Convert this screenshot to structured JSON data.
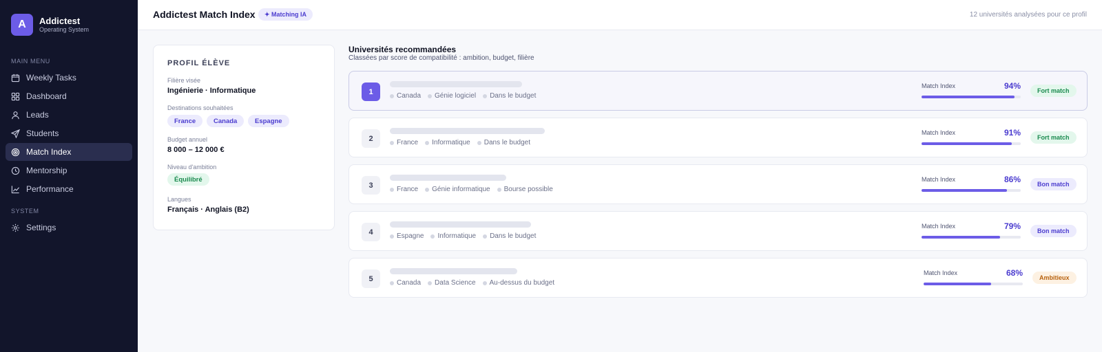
{
  "brand": {
    "logo_letter": "A",
    "name": "Addictest",
    "subtitle": "Operating System"
  },
  "sidebar": {
    "main_menu_label": "MAIN MENU",
    "main_items": [
      {
        "label": "Weekly Tasks",
        "icon": "calendar-icon"
      },
      {
        "label": "Dashboard",
        "icon": "grid-icon"
      },
      {
        "label": "Leads",
        "icon": "user-icon"
      },
      {
        "label": "Students",
        "icon": "send-icon"
      },
      {
        "label": "Match Index",
        "icon": "target-icon",
        "active": true
      },
      {
        "label": "Mentorship",
        "icon": "clock-icon"
      },
      {
        "label": "Performance",
        "icon": "chart-icon"
      }
    ],
    "system_label": "SYSTEM",
    "system_items": [
      {
        "label": "Settings",
        "icon": "gear-icon"
      }
    ]
  },
  "header": {
    "title": "Addictest Match Index",
    "badge": "✦ Matching IA",
    "note": "12 universités analysées pour ce profil"
  },
  "profile": {
    "title": "PROFIL ÉLÈVE",
    "field_label": "Filière visée",
    "field_value": "Ingénierie · Informatique",
    "destinations_label": "Destinations souhaitées",
    "destinations": [
      "France",
      "Canada",
      "Espagne"
    ],
    "budget_label": "Budget annuel",
    "budget_value": "8 000 – 12 000 €",
    "ambition_label": "Niveau d'ambition",
    "ambition_value": "Équilibré",
    "languages_label": "Langues",
    "languages_value": "Français · Anglais (B2)"
  },
  "recommendations": {
    "title": "Universités recommandées",
    "subtitle": "Classées par score de compatibilité : ambition, budget, filière",
    "match_label": "Match Index",
    "items": [
      {
        "rank": "1",
        "tags": [
          "Canada",
          "Génie logiciel",
          "Dans le budget"
        ],
        "score": 94,
        "score_label": "94%",
        "verdict": "Fort match",
        "verdict_type": "fort"
      },
      {
        "rank": "2",
        "tags": [
          "France",
          "Informatique",
          "Dans le budget"
        ],
        "score": 91,
        "score_label": "91%",
        "verdict": "Fort match",
        "verdict_type": "fort"
      },
      {
        "rank": "3",
        "tags": [
          "France",
          "Génie informatique",
          "Bourse possible"
        ],
        "score": 86,
        "score_label": "86%",
        "verdict": "Bon match",
        "verdict_type": "bon"
      },
      {
        "rank": "4",
        "tags": [
          "Espagne",
          "Informatique",
          "Dans le budget"
        ],
        "score": 79,
        "score_label": "79%",
        "verdict": "Bon match",
        "verdict_type": "bon"
      },
      {
        "rank": "5",
        "tags": [
          "Canada",
          "Data Science",
          "Au-dessus du budget"
        ],
        "score": 68,
        "score_label": "68%",
        "verdict": "Ambitieux",
        "verdict_type": "amb"
      }
    ]
  },
  "colors": {
    "accent": "#6c5ce7",
    "sidebar_bg": "#12152b",
    "success": "#1a8a4e",
    "warning": "#b8620f"
  }
}
